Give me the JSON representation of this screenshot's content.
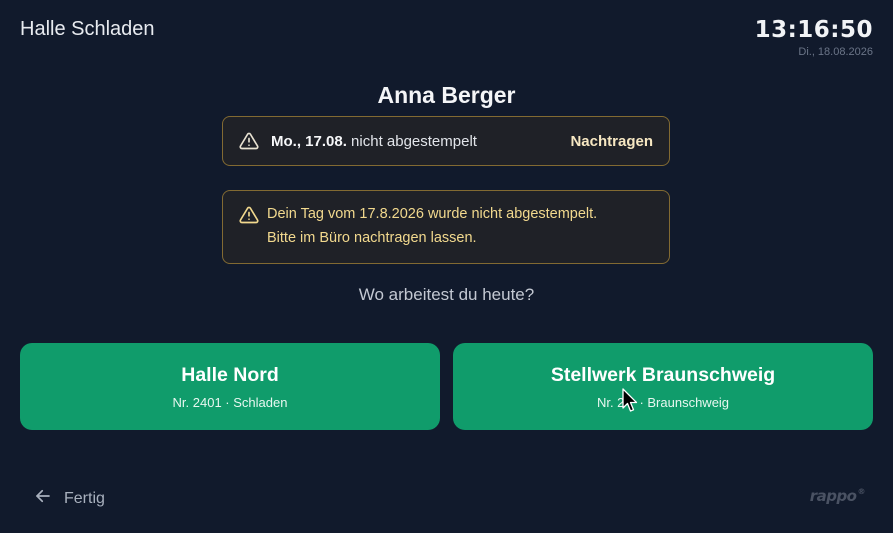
{
  "header": {
    "location": "Halle Schladen",
    "time": "13:16:50",
    "date": "Di., 18.08.2026"
  },
  "employee": {
    "name": "Anna Berger"
  },
  "missing_alert": {
    "date": "Mo., 17.08.",
    "message": "nicht abgestempelt",
    "action_label": "Nachtragen",
    "icon": "warning-icon"
  },
  "info_alert": {
    "line1": "Dein Tag vom 17.8.2026 wurde nicht abgestempelt.",
    "line2": "Bitte im Büro nachtragen lassen.",
    "icon": "warning-icon"
  },
  "question": "Wo arbeitest du heute?",
  "sites": [
    {
      "title": "Halle Nord",
      "subtitle": "Nr. 2401 · Schladen"
    },
    {
      "title": "Stellwerk Braunschweig",
      "subtitle": "Nr. 24   · Braunschweig"
    }
  ],
  "footer": {
    "back_label": "Fertig",
    "back_icon": "arrow-left-icon",
    "brand": "rappo",
    "brand_mark": "®"
  },
  "colors": {
    "background": "#111a2c",
    "accent": "#109c6b",
    "warning_border": "#826a32",
    "warning_text": "#f2d98e"
  }
}
